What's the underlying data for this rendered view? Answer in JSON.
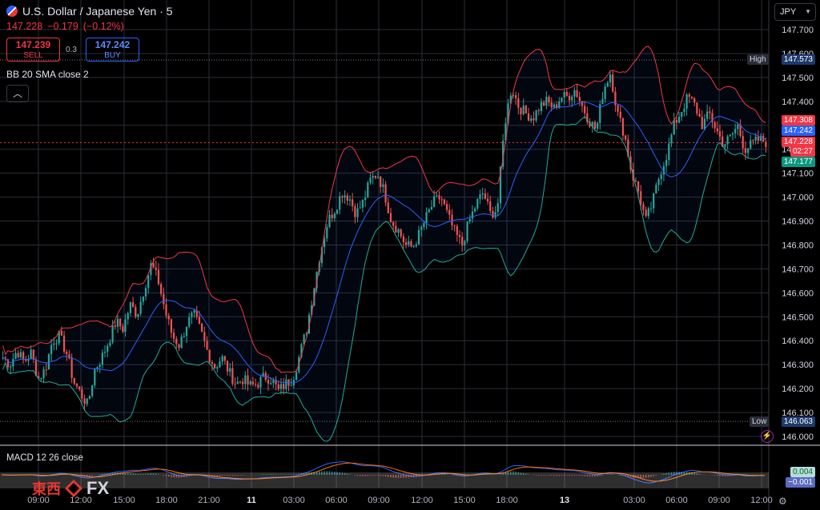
{
  "header": {
    "title": "U.S. Dollar / Japanese Yen · 5",
    "last_price": "147.228",
    "change": "−0.179",
    "change_pct": "(−0.12%)"
  },
  "trade": {
    "sell_price": "147.239",
    "sell_label": "SELL",
    "spread": "0.3",
    "buy_price": "147.242",
    "buy_label": "BUY"
  },
  "indicator": {
    "bb_label": "BB 20 SMA close 2",
    "collapse_icon": "chevron-up-icon",
    "macd_label": "MACD 12 26 close"
  },
  "currency_selector": {
    "value": "JPY"
  },
  "price_axis": {
    "ticks": [
      "147.700",
      "147.600",
      "147.500",
      "147.400",
      "147.300",
      "147.200",
      "147.100",
      "147.000",
      "146.900",
      "146.800",
      "146.700",
      "146.600",
      "146.500",
      "146.400",
      "146.300",
      "146.200",
      "146.100",
      "146.000"
    ],
    "high_label": "High",
    "high_value": "147.573",
    "low_label": "Low",
    "low_value": "146.063",
    "upper_band": "147.308",
    "basis_band": "147.242",
    "last": "147.228",
    "countdown": "02:27",
    "lower_band": "147.177",
    "colors": {
      "up": "#26a69a",
      "down": "#ef5350",
      "upper": "#f23645",
      "basis": "#2962ff",
      "lower": "#22ab94"
    }
  },
  "macd_axis": {
    "value1": "0.004",
    "value2": "−0.001"
  },
  "time_axis": [
    "09:00",
    "12:00",
    "15:00",
    "18:00",
    "21:00",
    "11",
    "03:00",
    "06:00",
    "09:00",
    "12:00",
    "15:00",
    "18:00",
    "13",
    "03:00",
    "06:00",
    "09:00",
    "12:00"
  ],
  "logo": {
    "text_jp": "東西",
    "text_fx": "FX"
  },
  "chart_data": {
    "type": "candlestick",
    "ylim": [
      146.0,
      147.7
    ],
    "close_path": [
      146.33,
      146.3,
      146.36,
      146.31,
      146.35,
      146.24,
      146.28,
      146.4,
      146.42,
      146.35,
      146.23,
      146.18,
      146.13,
      146.28,
      146.33,
      146.4,
      146.48,
      146.45,
      146.55,
      146.51,
      146.62,
      146.72,
      146.65,
      146.52,
      146.42,
      146.38,
      146.47,
      146.51,
      146.44,
      146.35,
      146.29,
      146.33,
      146.27,
      146.22,
      146.24,
      146.21,
      146.22,
      146.25,
      146.24,
      146.19,
      146.22,
      146.24,
      146.34,
      146.45,
      146.62,
      146.78,
      146.9,
      146.95,
      147.02,
      147.0,
      146.93,
      146.98,
      147.07,
      147.1,
      147.02,
      146.9,
      146.86,
      146.8,
      146.79,
      146.85,
      146.92,
      146.98,
      147.0,
      146.92,
      146.85,
      146.8,
      146.9,
      146.97,
      147.02,
      146.93,
      146.95,
      147.3,
      147.46,
      147.38,
      147.35,
      147.33,
      147.38,
      147.4,
      147.37,
      147.42,
      147.42,
      147.45,
      147.38,
      147.32,
      147.28,
      147.45,
      147.52,
      147.35,
      147.26,
      147.1,
      147.02,
      146.9,
      146.98,
      147.1,
      147.18,
      147.3,
      147.36,
      147.42,
      147.38,
      147.3,
      147.35,
      147.28,
      147.22,
      147.25,
      147.3,
      147.2,
      147.22,
      147.24,
      147.23
    ]
  }
}
